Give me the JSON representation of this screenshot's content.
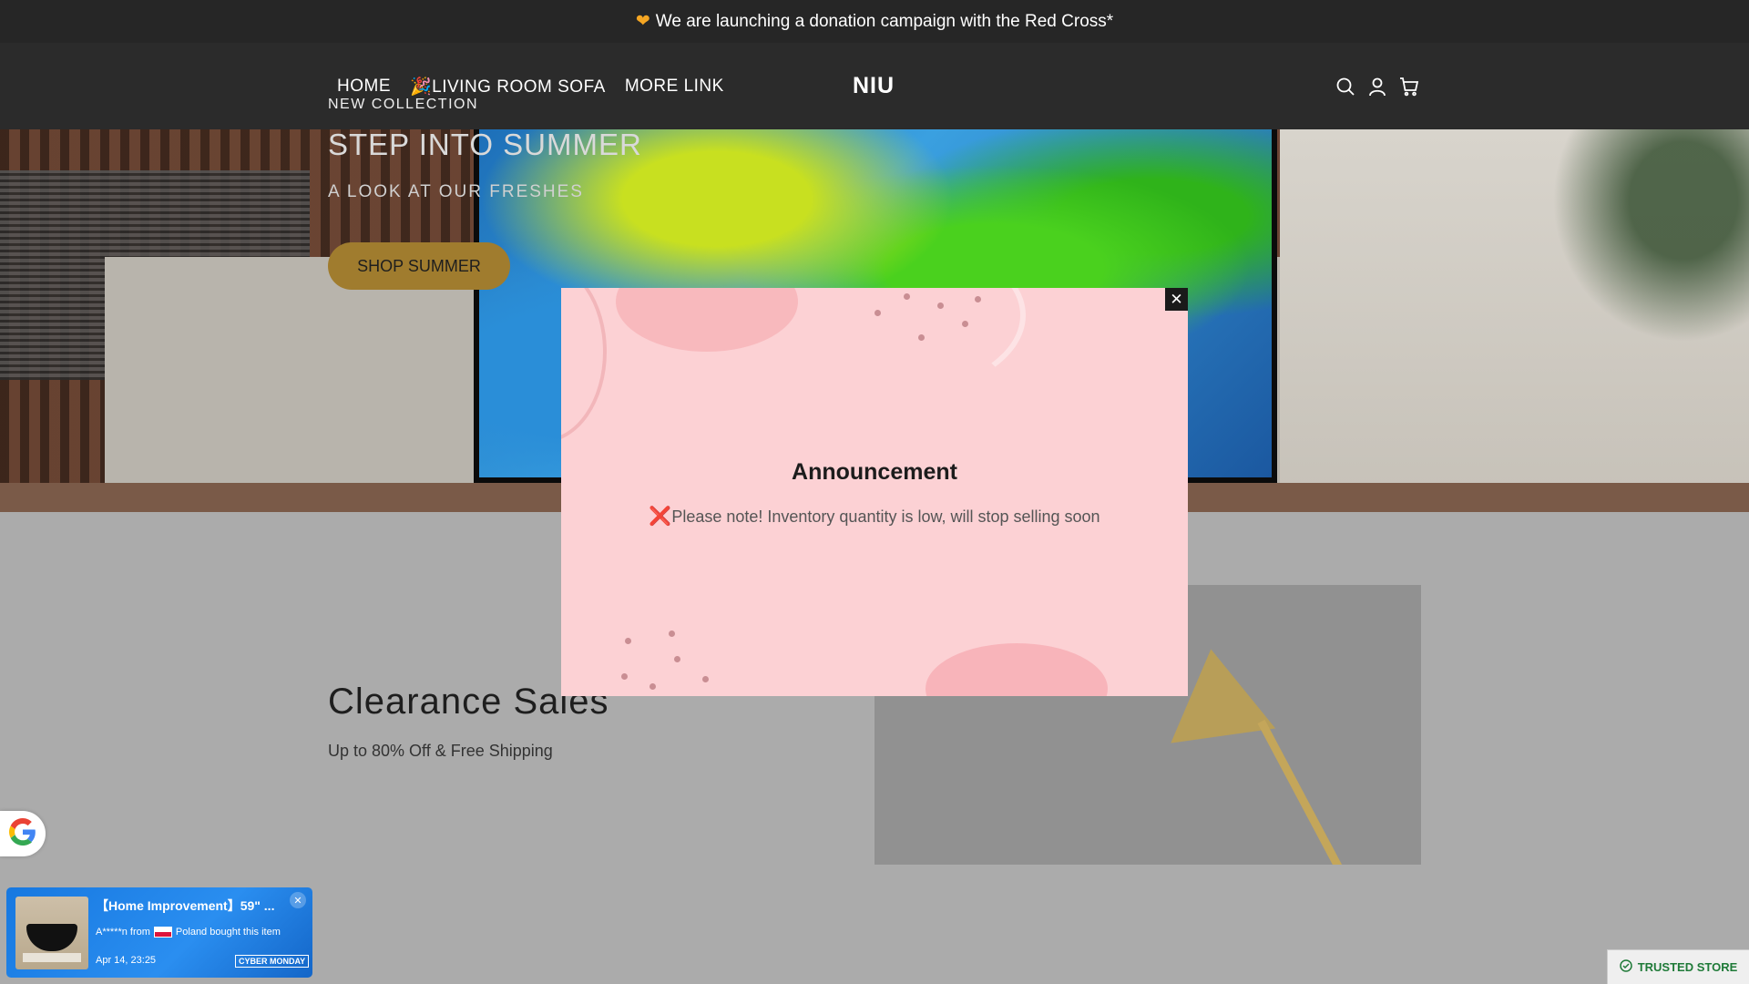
{
  "announcement": {
    "heart_icon": "heart-icon",
    "text": "We are launching a donation campaign with the Red Cross*"
  },
  "header": {
    "nav": [
      {
        "label": "HOME"
      },
      {
        "label": "🎉LIVING ROOM SOFA"
      },
      {
        "label": "MORE LINK"
      }
    ],
    "logo": "NIU",
    "icons": [
      "search-icon",
      "account-icon",
      "cart-icon"
    ]
  },
  "hero": {
    "eyebrow": "NEW COLLECTION",
    "title": "STEP INTO SUMMER",
    "subtitle": "A LOOK AT OUR FRESHES",
    "button": "SHOP SUMMER",
    "button_color": "#a07c2e"
  },
  "clearance": {
    "title": "Clearance Sales",
    "subtitle": "Up to 80% Off & Free Shipping"
  },
  "modal": {
    "title": "Announcement",
    "message": "Please note! Inventory quantity is low, will stop selling soon",
    "close": "✕",
    "background": "#fcd1d4"
  },
  "notification": {
    "title": "【Home Improvement】59\" ...",
    "buyer": "A*****n from",
    "country": "Poland bought this item",
    "date": "Apr 14, 23:25",
    "tag": "CYBER MONDAY",
    "close": "✕"
  },
  "trusted_store": {
    "label": "TRUSTED STORE",
    "color": "#1f7a38"
  }
}
